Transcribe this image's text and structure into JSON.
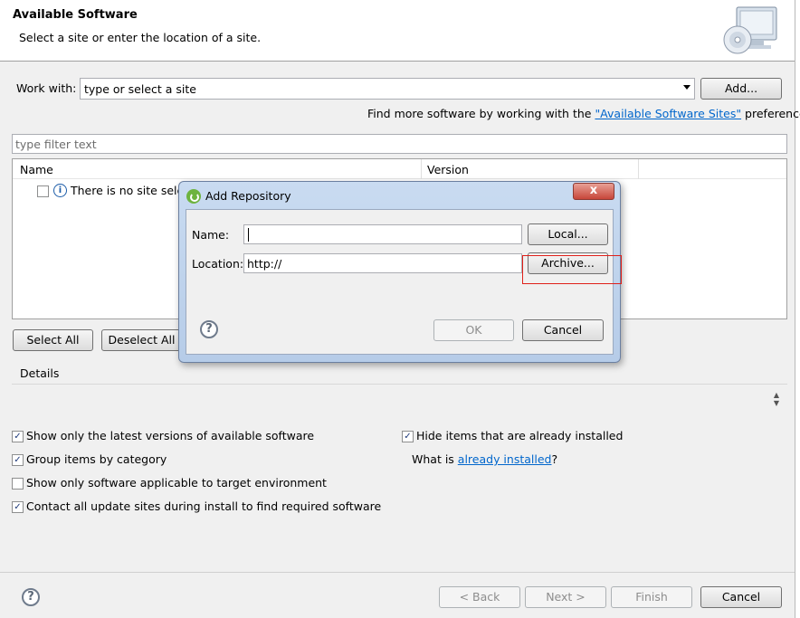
{
  "header": {
    "title": "Available Software",
    "subtitle": "Select a site or enter the location of a site."
  },
  "work_with": {
    "label": "Work with:",
    "combo_value": "type or select a site",
    "add_label": "Add...",
    "find_more_prefix": "Find more software by working with the ",
    "find_more_link": "\"Available Software Sites\"",
    "find_more_suffix": " preferences."
  },
  "filter": {
    "placeholder": "type filter text"
  },
  "table": {
    "columns": [
      "Name",
      "Version"
    ],
    "row_text": "There is no site selec"
  },
  "buttons": {
    "select_all": "Select All",
    "deselect_all": "Deselect All"
  },
  "details": {
    "label": "Details"
  },
  "options": {
    "show_latest": {
      "label": "Show only the latest versions of available software",
      "checked": true
    },
    "group_by_category": {
      "label": "Group items by category",
      "checked": true
    },
    "target_env": {
      "label": "Show only software applicable to target environment",
      "checked": false
    },
    "contact_all": {
      "label": "Contact all update sites during install to find required software",
      "checked": true
    },
    "hide_installed": {
      "label": "Hide items that are already installed",
      "checked": true
    },
    "what_is_prefix": "What is ",
    "what_is_link": "already installed",
    "what_is_suffix": "?"
  },
  "wizard_buttons": {
    "back": "< Back",
    "next": "Next >",
    "finish": "Finish",
    "cancel": "Cancel"
  },
  "dialog": {
    "title": "Add Repository",
    "close_symbol": "x",
    "name_label": "Name:",
    "name_value": "",
    "local_label": "Local...",
    "location_label": "Location:",
    "location_value": "http://",
    "archive_label": "Archive...",
    "ok_label": "OK",
    "cancel_label": "Cancel"
  },
  "help_symbol": "?",
  "info_symbol": "i",
  "colors": {
    "link": "#0066cc",
    "highlight": "#e0201a",
    "dialog_frame": "#b6cce8"
  }
}
